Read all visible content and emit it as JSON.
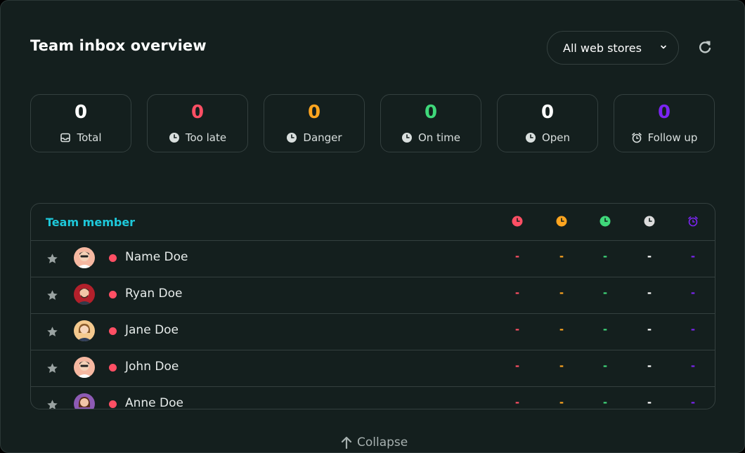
{
  "header": {
    "title": "Team inbox overview",
    "store_select": "All web stores"
  },
  "stats": [
    {
      "value": "0",
      "label": "Total",
      "color": "#ffffff",
      "icon": "inbox-icon"
    },
    {
      "value": "0",
      "label": "Too late",
      "color": "#ff4f64",
      "icon": "clock-icon"
    },
    {
      "value": "0",
      "label": "Danger",
      "color": "#ffa51f",
      "icon": "clock-icon"
    },
    {
      "value": "0",
      "label": "On time",
      "color": "#3fd87a",
      "icon": "clock-icon"
    },
    {
      "value": "0",
      "label": "Open",
      "color": "#ffffff",
      "icon": "clock-icon"
    },
    {
      "value": "0",
      "label": "Follow up",
      "color": "#7b24f2",
      "icon": "alarm-icon"
    }
  ],
  "table": {
    "header_label": "Team member",
    "columns": [
      {
        "icon": "too-late-clock-icon",
        "color": "#ff4f64"
      },
      {
        "icon": "danger-clock-icon",
        "color": "#ffa51f"
      },
      {
        "icon": "on-time-clock-icon",
        "color": "#3fd87a"
      },
      {
        "icon": "open-clock-icon",
        "color": "#dcdcdc"
      },
      {
        "icon": "follow-up-alarm-icon",
        "color": "#7b24f2"
      }
    ],
    "rows": [
      {
        "name": "Name Doe",
        "status_color": "#ff4f64",
        "values": [
          "-",
          "-",
          "-",
          "-",
          "-"
        ]
      },
      {
        "name": "Ryan Doe",
        "status_color": "#ff4f64",
        "values": [
          "-",
          "-",
          "-",
          "-",
          "-"
        ]
      },
      {
        "name": "Jane Doe",
        "status_color": "#ff4f64",
        "values": [
          "-",
          "-",
          "-",
          "-",
          "-"
        ]
      },
      {
        "name": "John Doe",
        "status_color": "#ff4f64",
        "values": [
          "-",
          "-",
          "-",
          "-",
          "-"
        ]
      },
      {
        "name": "Anne Doe",
        "status_color": "#ff4f64",
        "values": [
          "-",
          "-",
          "-",
          "-",
          "-"
        ]
      }
    ]
  },
  "footer": {
    "collapse_label": "Collapse"
  }
}
